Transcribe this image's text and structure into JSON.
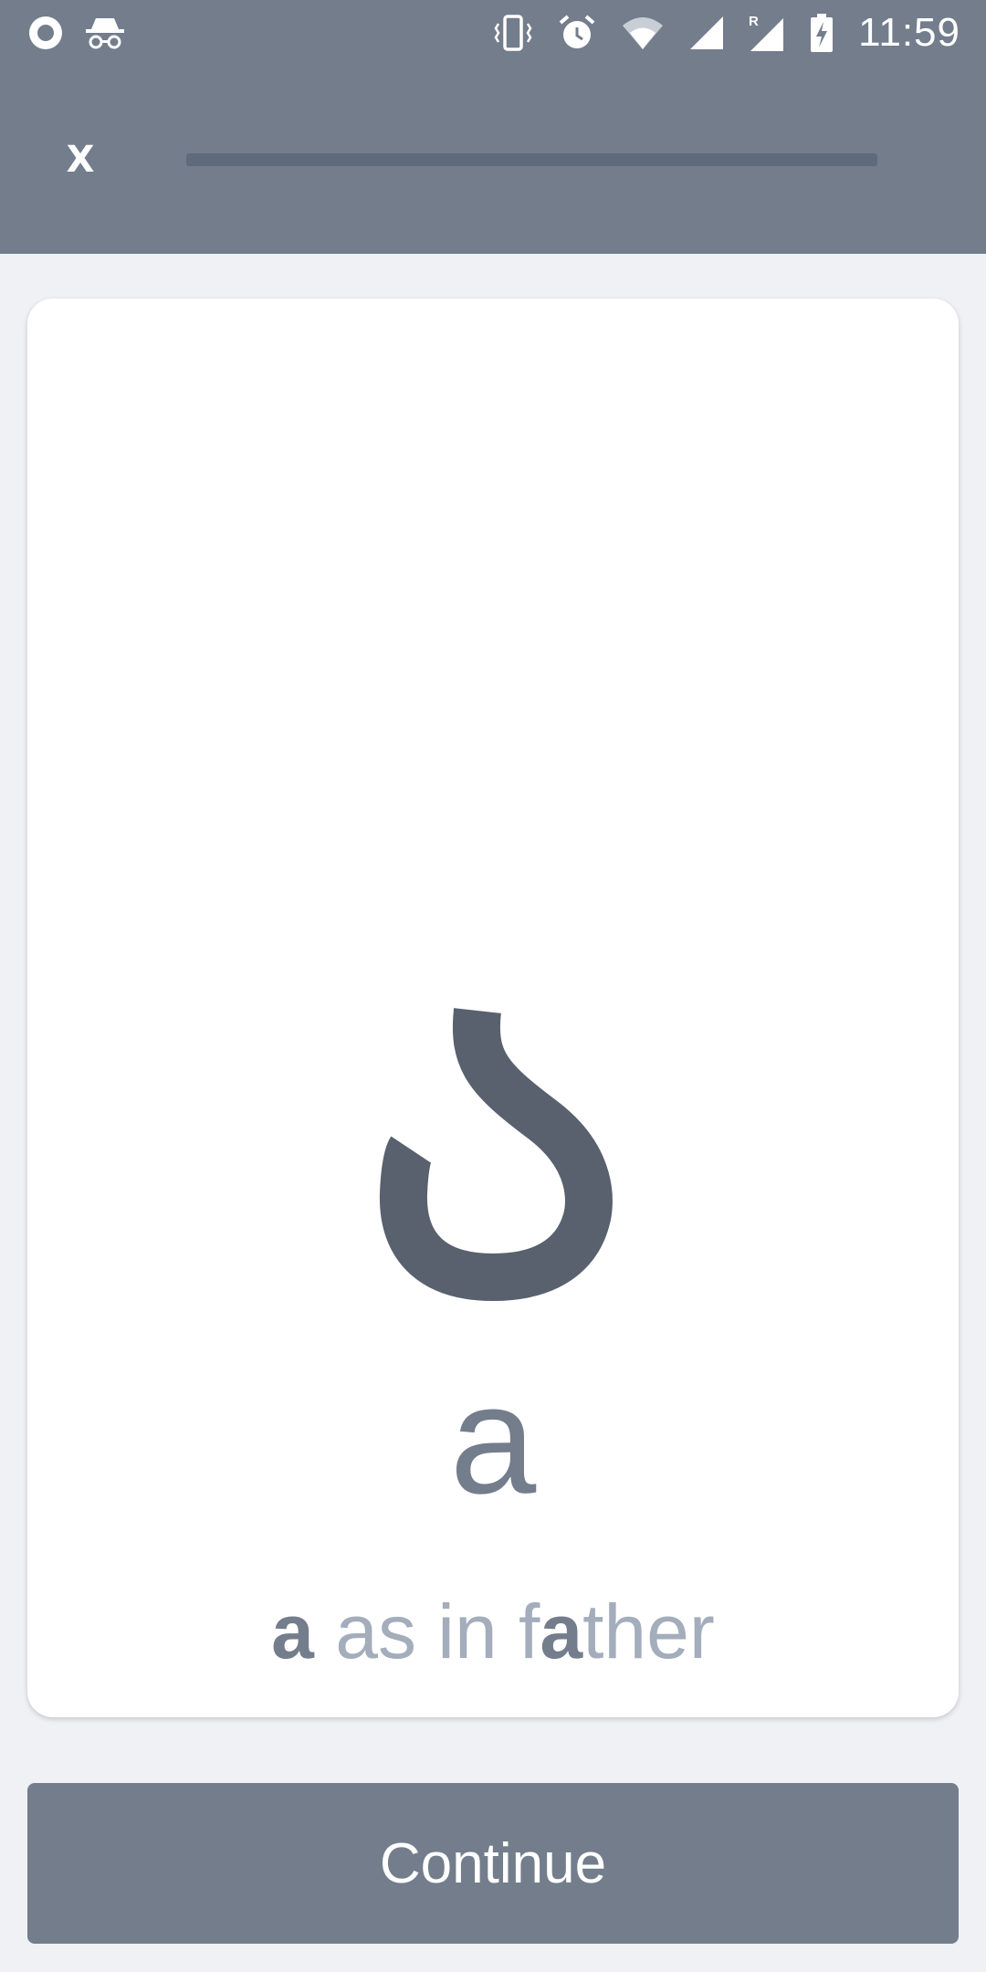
{
  "status_bar": {
    "time": "11:59",
    "left_icons": [
      "record-icon",
      "incognito-icon"
    ],
    "right_icons": [
      "vibrate-icon",
      "alarm-icon",
      "wifi-icon",
      "signal-icon",
      "roaming-signal-icon",
      "battery-charging-icon"
    ],
    "roaming_label": "R"
  },
  "header": {
    "close_label": "X",
    "progress_fraction": 0.0
  },
  "card": {
    "script_character": "ر",
    "latin_letter": "a",
    "example": {
      "key_letter": "a",
      "before": "as in f",
      "highlight": "a",
      "after": "ther"
    }
  },
  "continue_button": {
    "label": "Continue"
  },
  "colors": {
    "header_bg": "#737d8c",
    "page_bg": "#f0f1f5",
    "card_bg": "#ffffff",
    "glyph": "#59606e",
    "muted_text": "#a3adbb",
    "button_bg": "#737d8c"
  }
}
